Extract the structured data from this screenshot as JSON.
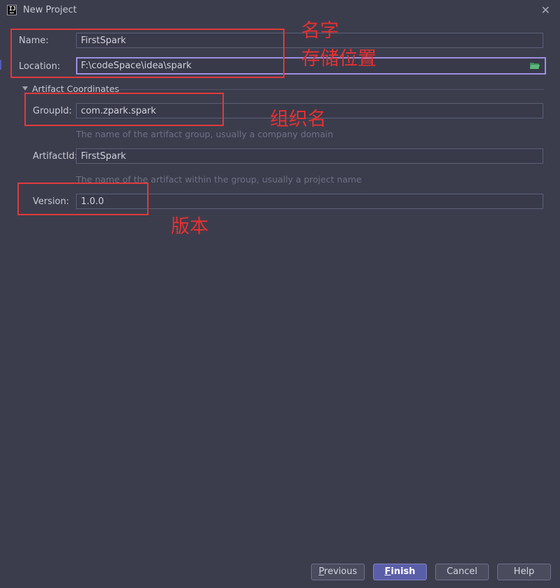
{
  "window": {
    "title": "New Project",
    "close_glyph": "✕",
    "app_icon_text": "IJ"
  },
  "form": {
    "name": {
      "label": "Name:",
      "value": "FirstSpark"
    },
    "location": {
      "label": "Location:",
      "value": "F:\\codeSpace\\idea\\spark"
    },
    "section_title": "Artifact Coordinates",
    "group_id": {
      "label": "GroupId:",
      "value": "com.zpark.spark",
      "hint": "The name of the artifact group, usually a company domain"
    },
    "artifact_id": {
      "label": "ArtifactId:",
      "value": "FirstSpark",
      "hint": "The name of the artifact within the group, usually a project name"
    },
    "version": {
      "label": "Version:",
      "value": "1.0.0"
    }
  },
  "annotations": {
    "name": "名字",
    "location": "存储位置",
    "group_id": "组织名",
    "version": "版本"
  },
  "buttons": {
    "previous": "Previous",
    "finish": "Finish",
    "cancel": "Cancel",
    "help": "Help"
  },
  "colors": {
    "accent": "#5a5ea8",
    "annotation_red": "#e03a3a",
    "background": "#3b3d4d"
  }
}
